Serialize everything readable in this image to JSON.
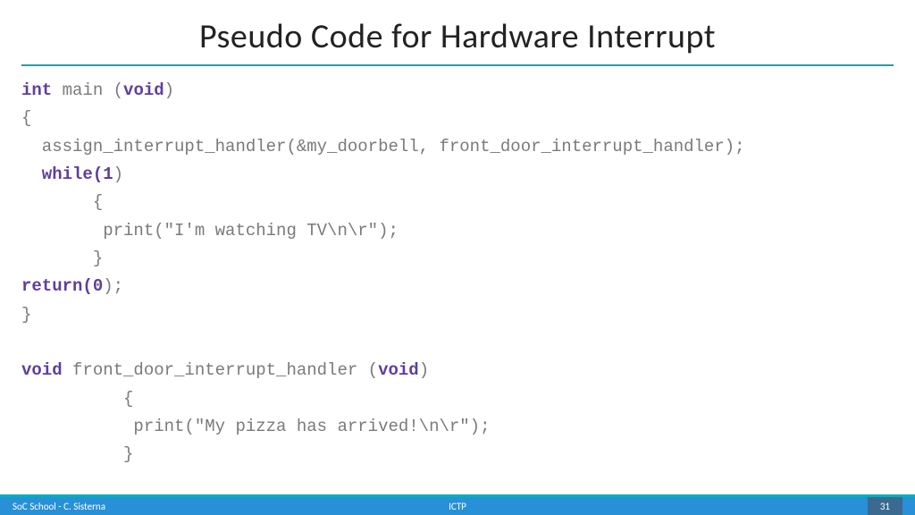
{
  "title": "Pseudo Code for Hardware Interrupt",
  "code": {
    "l1_kw1": "int",
    "l1_txt1": " main (",
    "l1_kw2": "void",
    "l1_txt2": ")",
    "l2": "{",
    "l3": "  assign_interrupt_handler(&my_doorbell, front_door_interrupt_handler);",
    "l4_kw": "  while(1",
    "l4_txt": ")",
    "l5": "       {",
    "l6": "        print(\"I'm watching TV\\n\\r\");",
    "l7": "       }",
    "l8_kw": "return(0",
    "l8_txt": ");",
    "l9": "}",
    "l10": "",
    "l11_kw1": "void",
    "l11_txt1": " front_door_interrupt_handler (",
    "l11_kw2": "void",
    "l11_txt2": ")",
    "l12": "          {",
    "l13": "           print(\"My pizza has arrived!\\n\\r\");",
    "l14": "          }"
  },
  "footer": {
    "left": "SoC School - C. Sisterna",
    "center": "ICTP",
    "page": "31"
  }
}
